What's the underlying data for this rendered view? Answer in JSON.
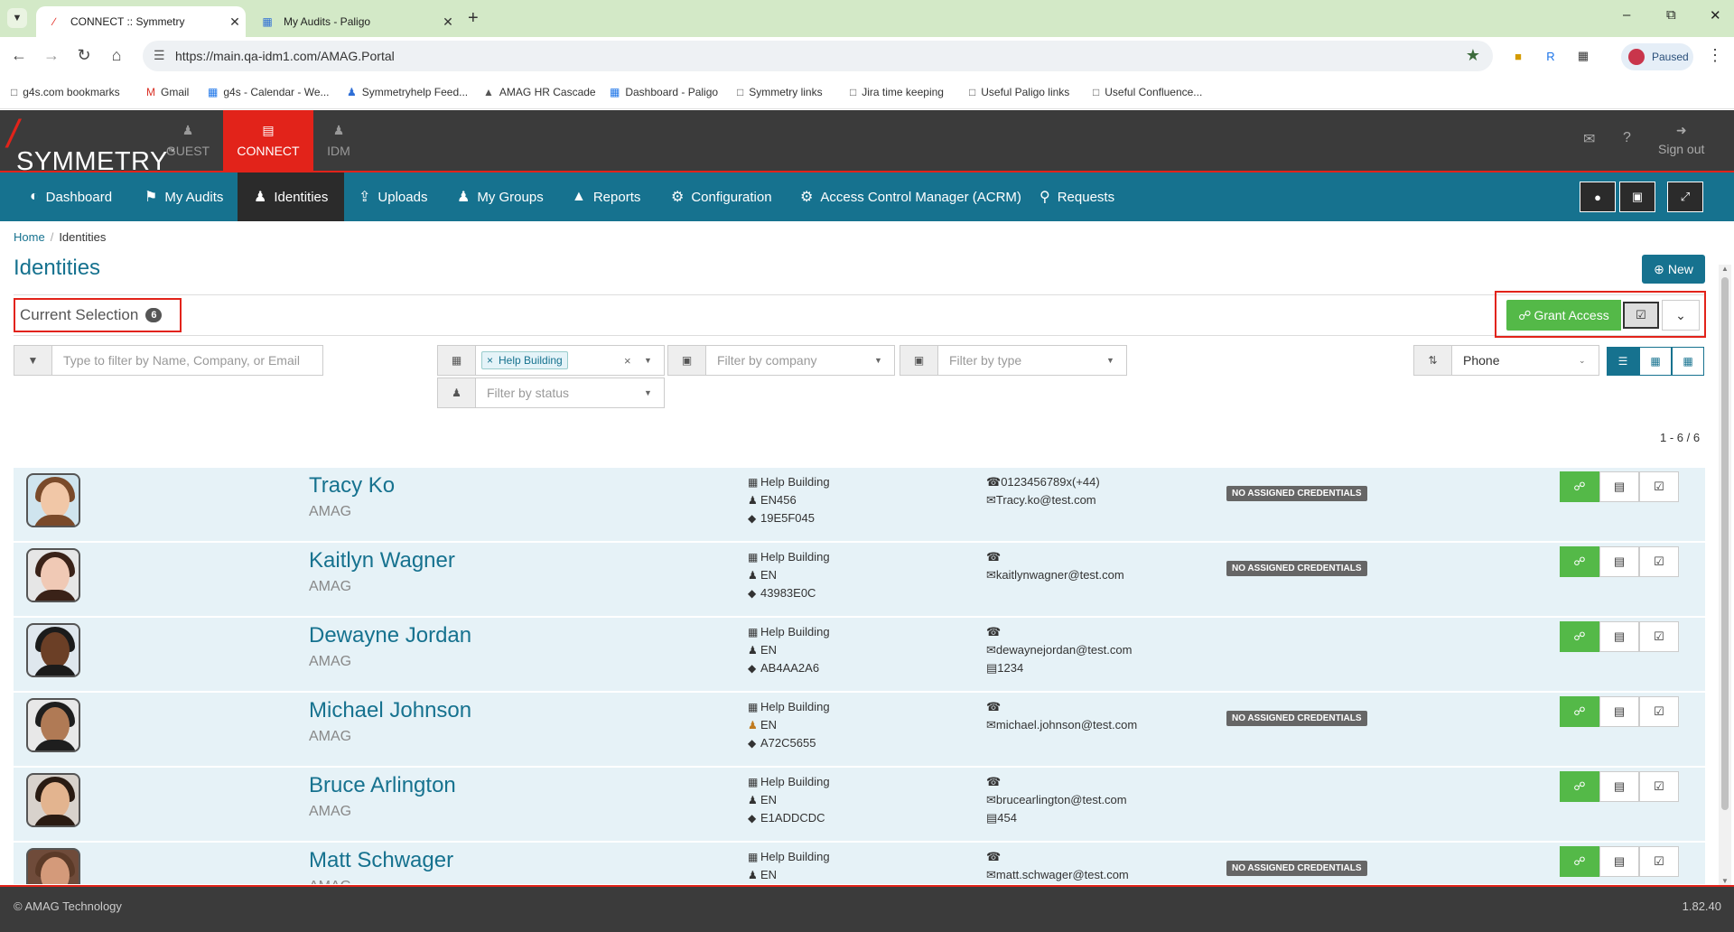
{
  "browser": {
    "tabs": [
      {
        "title": "CONNECT :: Symmetry",
        "active": true
      },
      {
        "title": "My Audits - Paligo",
        "active": false
      }
    ],
    "url": "https://main.qa-idm1.com/AMAG.Portal",
    "profile_status": "Paused",
    "bookmarks": [
      "g4s.com bookmarks",
      "Gmail",
      "g4s - Calendar - We...",
      "Symmetryhelp Feed...",
      "AMAG HR Cascade",
      "Dashboard - Paligo",
      "Symmetry links",
      "Jira time keeping",
      "Useful Paligo links",
      "Useful Confluence..."
    ]
  },
  "header": {
    "logo": "SYMMETRY",
    "logo_tm": "™",
    "modules": [
      {
        "label": "GUEST",
        "active": false
      },
      {
        "label": "CONNECT",
        "active": true
      },
      {
        "label": "IDM",
        "active": false
      }
    ],
    "sign_out": "Sign out"
  },
  "nav": {
    "items": [
      {
        "label": "Dashboard",
        "icon": "dashboard-icon"
      },
      {
        "label": "My Audits",
        "icon": "flag-icon"
      },
      {
        "label": "Identities",
        "icon": "user-icon",
        "active": true
      },
      {
        "label": "Uploads",
        "icon": "upload-icon"
      },
      {
        "label": "My Groups",
        "icon": "users-icon"
      },
      {
        "label": "Reports",
        "icon": "chart-icon"
      },
      {
        "label": "Configuration",
        "icon": "gear-icon"
      },
      {
        "label": "Access Control Manager (ACRM)",
        "icon": "gear-icon"
      },
      {
        "label": "Requests",
        "icon": "key-icon"
      }
    ]
  },
  "breadcrumb": {
    "home": "Home",
    "current": "Identities"
  },
  "page": {
    "title": "Identities",
    "new_button": "New",
    "current_selection_label": "Current Selection",
    "current_selection_count": "6",
    "grant_access_label": "Grant Access",
    "pagination": "1 - 6 / 6"
  },
  "filters": {
    "search_placeholder": "Type to filter by Name, Company, or Email",
    "building_tag": "Help Building",
    "company_placeholder": "Filter by company",
    "type_placeholder": "Filter by type",
    "status_placeholder": "Filter by status",
    "sort_value": "Phone"
  },
  "credential_badge": "NO ASSIGNED CREDENTIALS",
  "identities": [
    {
      "name": "Tracy Ko",
      "company": "AMAG",
      "building": "Help Building",
      "dept": "EN456",
      "tag": "19E5F045",
      "phone": "0123456789x(+44)",
      "email": "Tracy.ko@test.com",
      "card": "",
      "no_credentials": true,
      "avatar_skin": "#f1c7a7",
      "avatar_hair": "#7a4a2a",
      "avatar_bg": "#cfe4ee"
    },
    {
      "name": "Kaitlyn Wagner",
      "company": "AMAG",
      "building": "Help Building",
      "dept": "EN",
      "tag": "43983E0C",
      "phone": "",
      "email": "kaitlynwagner@test.com",
      "card": "",
      "no_credentials": true,
      "avatar_skin": "#f0c9b5",
      "avatar_hair": "#3a2218",
      "avatar_bg": "#e6e6e6"
    },
    {
      "name": "Dewayne Jordan",
      "company": "AMAG",
      "building": "Help Building",
      "dept": "EN",
      "tag": "AB4AA2A6",
      "phone": "",
      "email": "dewaynejordan@test.com",
      "card": "1234",
      "no_credentials": false,
      "avatar_skin": "#6b3f26",
      "avatar_hair": "#1b1b1b",
      "avatar_bg": "#dfe7ee"
    },
    {
      "name": "Michael Johnson",
      "company": "AMAG",
      "building": "Help Building",
      "dept": "EN",
      "tag": "A72C5655",
      "phone": "",
      "email": "michael.johnson@test.com",
      "card": "",
      "no_credentials": true,
      "avatar_skin": "#b07a55",
      "avatar_hair": "#1e1e1e",
      "avatar_bg": "#e8e8e8"
    },
    {
      "name": "Bruce Arlington",
      "company": "AMAG",
      "building": "Help Building",
      "dept": "EN",
      "tag": "E1ADDCDC",
      "phone": "",
      "email": "brucearlington@test.com",
      "card": "454",
      "no_credentials": false,
      "avatar_skin": "#e3b48f",
      "avatar_hair": "#2a1b12",
      "avatar_bg": "#d8d2cc"
    },
    {
      "name": "Matt Schwager",
      "company": "AMAG",
      "building": "Help Building",
      "dept": "EN",
      "tag": "",
      "phone": "",
      "email": "matt.schwager@test.com",
      "card": "",
      "no_credentials": true,
      "avatar_skin": "#d49a7a",
      "avatar_hair": "#5b3a28",
      "avatar_bg": "#6f4b3a"
    }
  ],
  "footer": {
    "copyright": "© AMAG Technology",
    "version": "1.82.40"
  },
  "colors": {
    "brand_teal": "#16728f",
    "accent_red": "#e2231a",
    "grant_green": "#54b948",
    "header_dark": "#3b3b3b"
  }
}
